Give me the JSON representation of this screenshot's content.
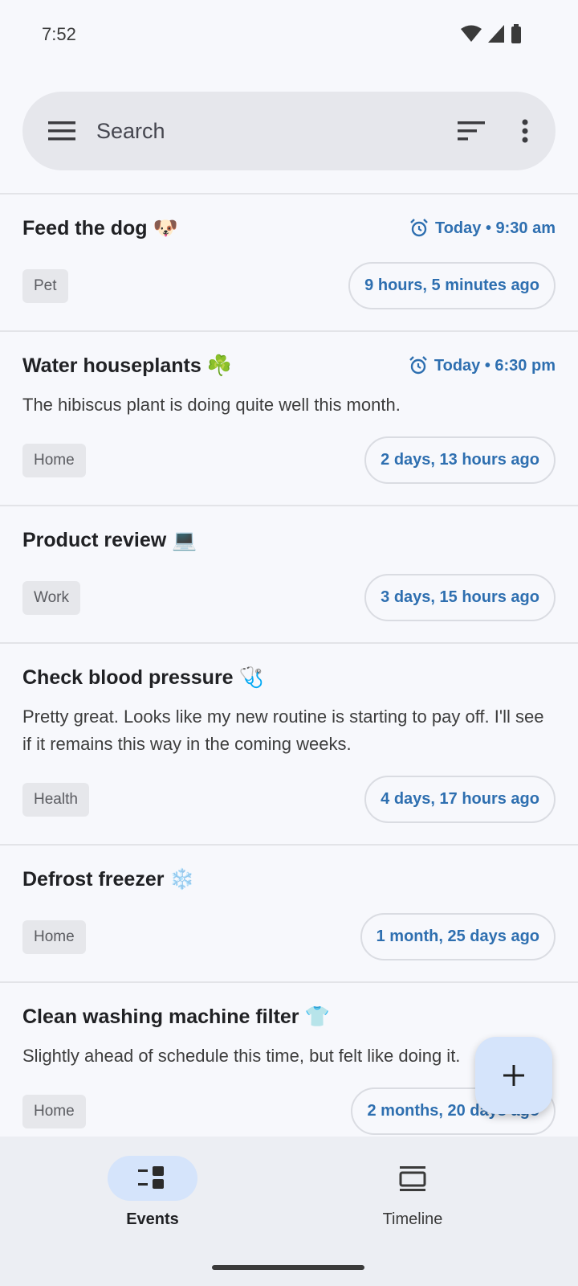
{
  "status_bar": {
    "time": "7:52"
  },
  "search": {
    "placeholder": "Search"
  },
  "events": [
    {
      "title": "Feed the dog 🐶",
      "alarm": "Today • 9:30 am",
      "description": "",
      "tag": "Pet",
      "ago": "9 hours, 5 minutes ago"
    },
    {
      "title": "Water houseplants ☘️",
      "alarm": "Today • 6:30 pm",
      "description": "The hibiscus plant is doing quite well this month.",
      "tag": "Home",
      "ago": "2 days, 13 hours ago"
    },
    {
      "title": "Product review 💻",
      "alarm": "",
      "description": "",
      "tag": "Work",
      "ago": "3 days, 15 hours ago"
    },
    {
      "title": "Check blood pressure 🩺",
      "alarm": "",
      "description": "Pretty great. Looks like my new routine is starting to pay off. I'll see if it remains this way in the coming weeks.",
      "tag": "Health",
      "ago": "4 days, 17 hours ago"
    },
    {
      "title": "Defrost freezer ❄️",
      "alarm": "",
      "description": "",
      "tag": "Home",
      "ago": "1 month, 25 days ago"
    },
    {
      "title": "Clean washing machine filter 👕",
      "alarm": "",
      "description": "Slightly ahead of schedule this time, but felt like doing it.",
      "tag": "Home",
      "ago": "2 months, 20 days ago"
    }
  ],
  "bottom_nav": {
    "events_label": "Events",
    "timeline_label": "Timeline"
  },
  "colors": {
    "accent": "#2e6fb0",
    "pill": "#d5e4fb"
  }
}
